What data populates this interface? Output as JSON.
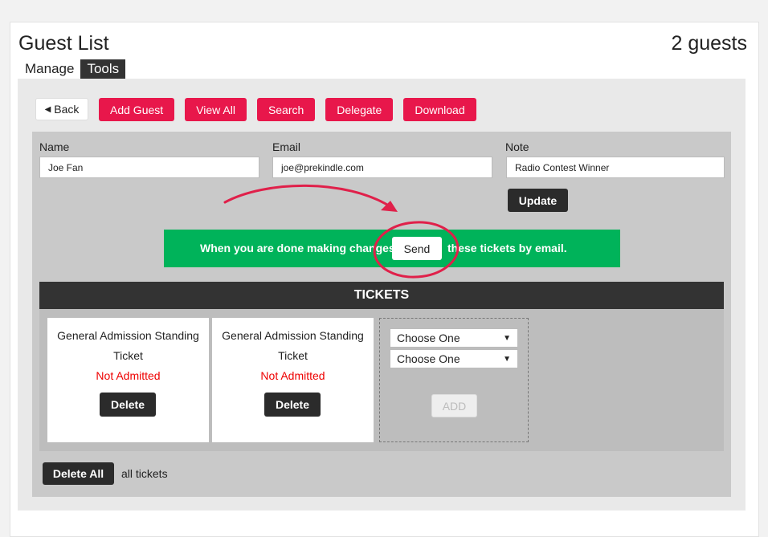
{
  "header": {
    "title": "Guest List",
    "guest_count": "2 guests"
  },
  "tabs": [
    {
      "label": "Manage",
      "active": false
    },
    {
      "label": "Tools",
      "active": true
    }
  ],
  "toolbar": {
    "back_label": "Back",
    "back_icon": "caret-left-icon",
    "buttons": [
      "Add Guest",
      "View All",
      "Search",
      "Delegate",
      "Download"
    ]
  },
  "form": {
    "name": {
      "label": "Name",
      "value": "Joe Fan"
    },
    "email": {
      "label": "Email",
      "value": "joe@prekindle.com"
    },
    "note": {
      "label": "Note",
      "value": "Radio Contest Winner"
    },
    "update_label": "Update"
  },
  "banner": {
    "text_before": "When you are done making changes",
    "send_label": "Send",
    "text_after": "these tickets by email."
  },
  "tickets": {
    "header": "TICKETS",
    "items": [
      {
        "name": "General Admission Standing Ticket",
        "status": "Not Admitted",
        "delete_label": "Delete"
      },
      {
        "name": "General Admission Standing Ticket",
        "status": "Not Admitted",
        "delete_label": "Delete"
      }
    ],
    "add": {
      "select_1": "Choose One",
      "select_2": "Choose One",
      "add_label": "ADD"
    }
  },
  "footer": {
    "delete_all_label": "Delete All",
    "suffix": "all tickets"
  },
  "colors": {
    "accent_red": "#e8174b",
    "green": "#00b35a",
    "dark": "#333333",
    "status_red": "#ee0000",
    "annotation": "#e0204a"
  }
}
